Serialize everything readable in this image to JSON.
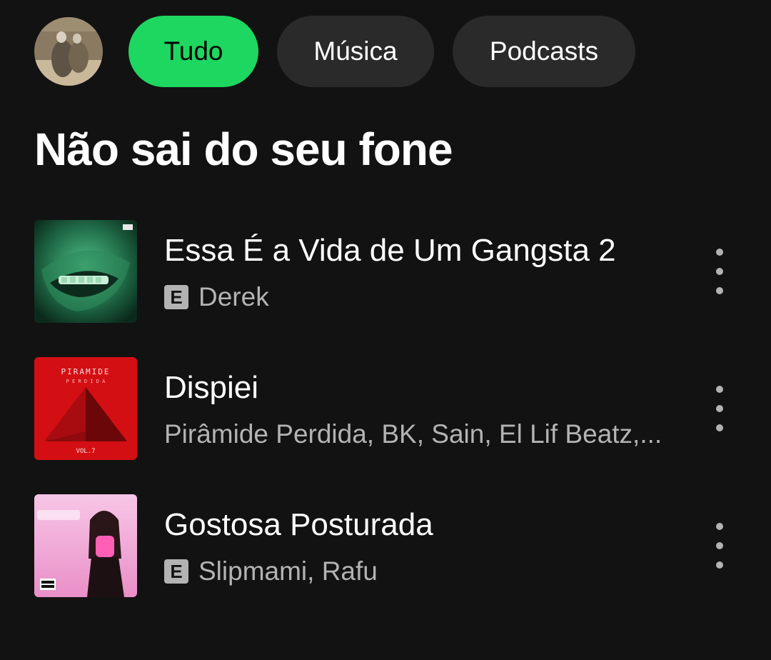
{
  "filters": [
    {
      "label": "Tudo",
      "active": true
    },
    {
      "label": "Música",
      "active": false
    },
    {
      "label": "Podcasts",
      "active": false
    }
  ],
  "section": {
    "title": "Não sai do seu fone"
  },
  "tracks": [
    {
      "title": "Essa É a Vida de Um Gangsta 2",
      "explicit": true,
      "explicit_badge": "E",
      "artists": "Derek",
      "cover_icon": "green-grillz-cover"
    },
    {
      "title": "Dispiei",
      "explicit": false,
      "artists": "Pirâmide Perdida, BK, Sain, El Lif Beatz,...",
      "cover_icon": "red-pyramid-cover",
      "cover_text": {
        "line1": "PIRAMIDE",
        "line2": "P E R D I D A",
        "vol": "VOL.7"
      }
    },
    {
      "title": "Gostosa Posturada",
      "explicit": true,
      "explicit_badge": "E",
      "artists": "Slipmami, Rafu",
      "cover_icon": "pink-portrait-cover"
    }
  ],
  "colors": {
    "background": "#121212",
    "accent": "#1ed760",
    "chip": "#2a2a2a",
    "secondary_text": "#b3b3b3"
  }
}
